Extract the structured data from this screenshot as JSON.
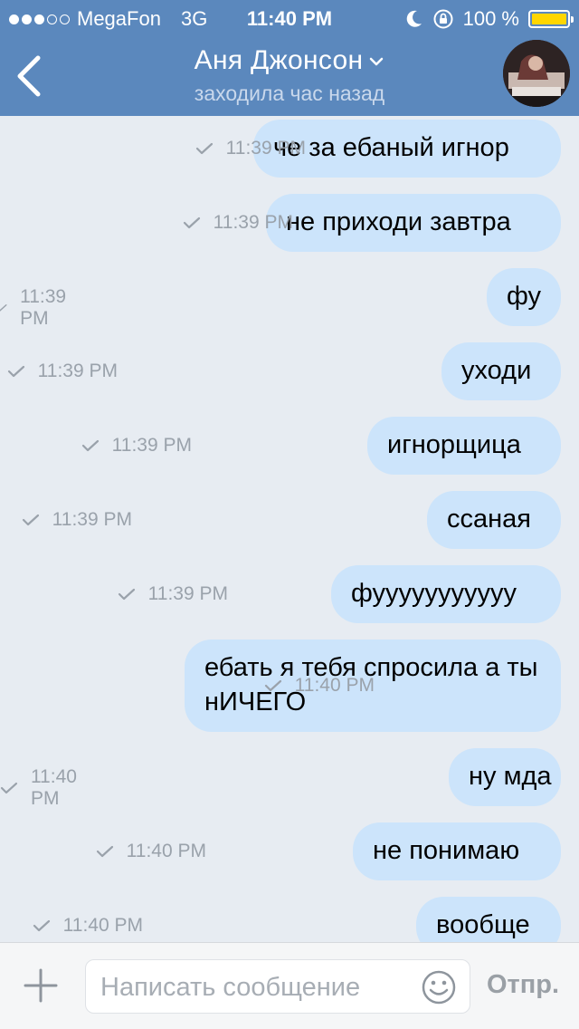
{
  "status_bar": {
    "carrier": "MegaFon",
    "network": "3G",
    "time": "11:40 PM",
    "battery_percent": "100 %",
    "signal_dots_filled": 3,
    "signal_dots_total": 5,
    "battery_color": "#ffd600"
  },
  "header": {
    "contact_name": "Аня Джонсон",
    "last_seen": "заходила час назад",
    "back_icon": "chevron-left-icon",
    "avatar": "contact-avatar",
    "accent": "#5b88bd"
  },
  "messages": [
    {
      "text": "че за ебаный игнор",
      "time": "11:39 PM"
    },
    {
      "text": "не приходи завтра",
      "time": "11:39 PM"
    },
    {
      "text": "фу",
      "time": "11:39 PM"
    },
    {
      "text": "уходи",
      "time": "11:39 PM"
    },
    {
      "text": "игнорщица",
      "time": "11:39 PM"
    },
    {
      "text": "ссаная",
      "time": "11:39 PM"
    },
    {
      "text": "фууууууууууу",
      "time": "11:39 PM"
    },
    {
      "text": "ебать я тебя спросила а ты нИЧЕГО",
      "time": "11:40 PM"
    },
    {
      "text": "ну мда",
      "time": "11:40 PM"
    },
    {
      "text": "не понимаю",
      "time": "11:40 PM"
    },
    {
      "text": "вообще",
      "time": "11:40 PM"
    }
  ],
  "composer": {
    "placeholder": "Написать сообщение",
    "send_label": "Отпр.",
    "attach_icon": "plus-icon",
    "emoji_icon": "smile-icon"
  },
  "colors": {
    "bubble": "#cce4fb",
    "background": "#e7ecf2"
  }
}
